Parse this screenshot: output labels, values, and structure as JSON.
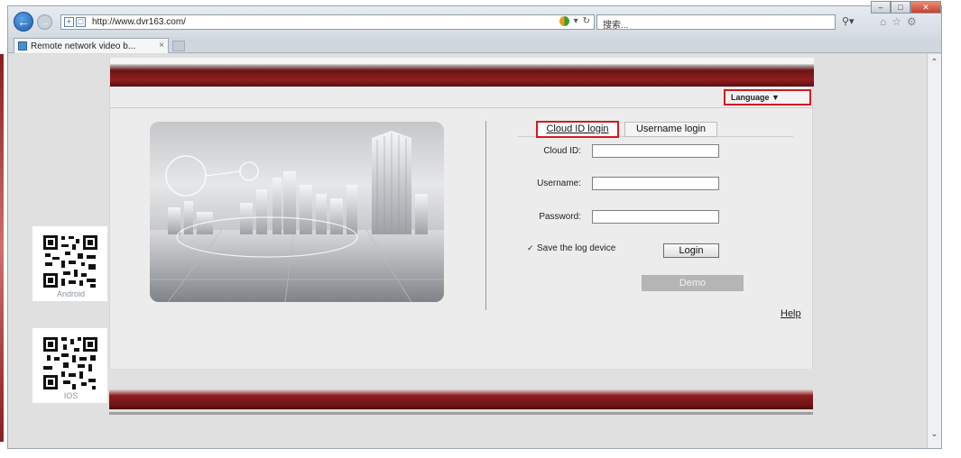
{
  "browser": {
    "url": "http://www.dvr163.com/",
    "search_placeholder": "搜索...",
    "tab_title": "Remote network video b...",
    "tab_close": "×"
  },
  "header": {
    "language_label": "Language ▼"
  },
  "login": {
    "tab_cloud": "Cloud ID login",
    "tab_username": "Username login",
    "cloud_id_label": "Cloud ID:",
    "username_label": "Username:",
    "password_label": "Password:",
    "save_label": "Save the log device",
    "save_checked": true,
    "login_button": "Login",
    "demo_button": "Demo",
    "help_link": "Help"
  },
  "qr": {
    "android_label": "Android",
    "ios_label": "IOS"
  },
  "icons": {
    "back": "back-arrow-icon",
    "forward": "forward-arrow-icon",
    "home": "home-icon",
    "favorites": "star-icon",
    "settings": "gear-icon"
  },
  "colors": {
    "accent_red": "#d01a21",
    "band_red": "#8e1d20",
    "demo_gray": "#b5b5b5"
  }
}
